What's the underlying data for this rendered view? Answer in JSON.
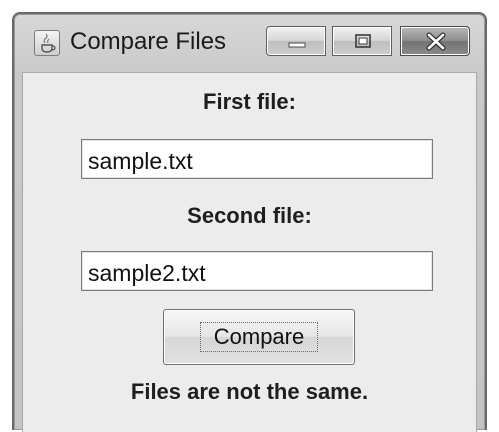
{
  "window": {
    "title": "Compare Files",
    "app_icon": "java-coffee-cup-icon",
    "controls": {
      "minimize_icon": "minimize-icon",
      "maximize_icon": "maximize-icon",
      "close_icon": "close-icon"
    }
  },
  "form": {
    "first_label": "First file:",
    "first_value": "sample.txt",
    "second_label": "Second file:",
    "second_value": "sample2.txt",
    "compare_label": "Compare",
    "status": "Files are not the same."
  },
  "colors": {
    "client_background": "#ececec",
    "close_button": "#8e8e8e"
  }
}
